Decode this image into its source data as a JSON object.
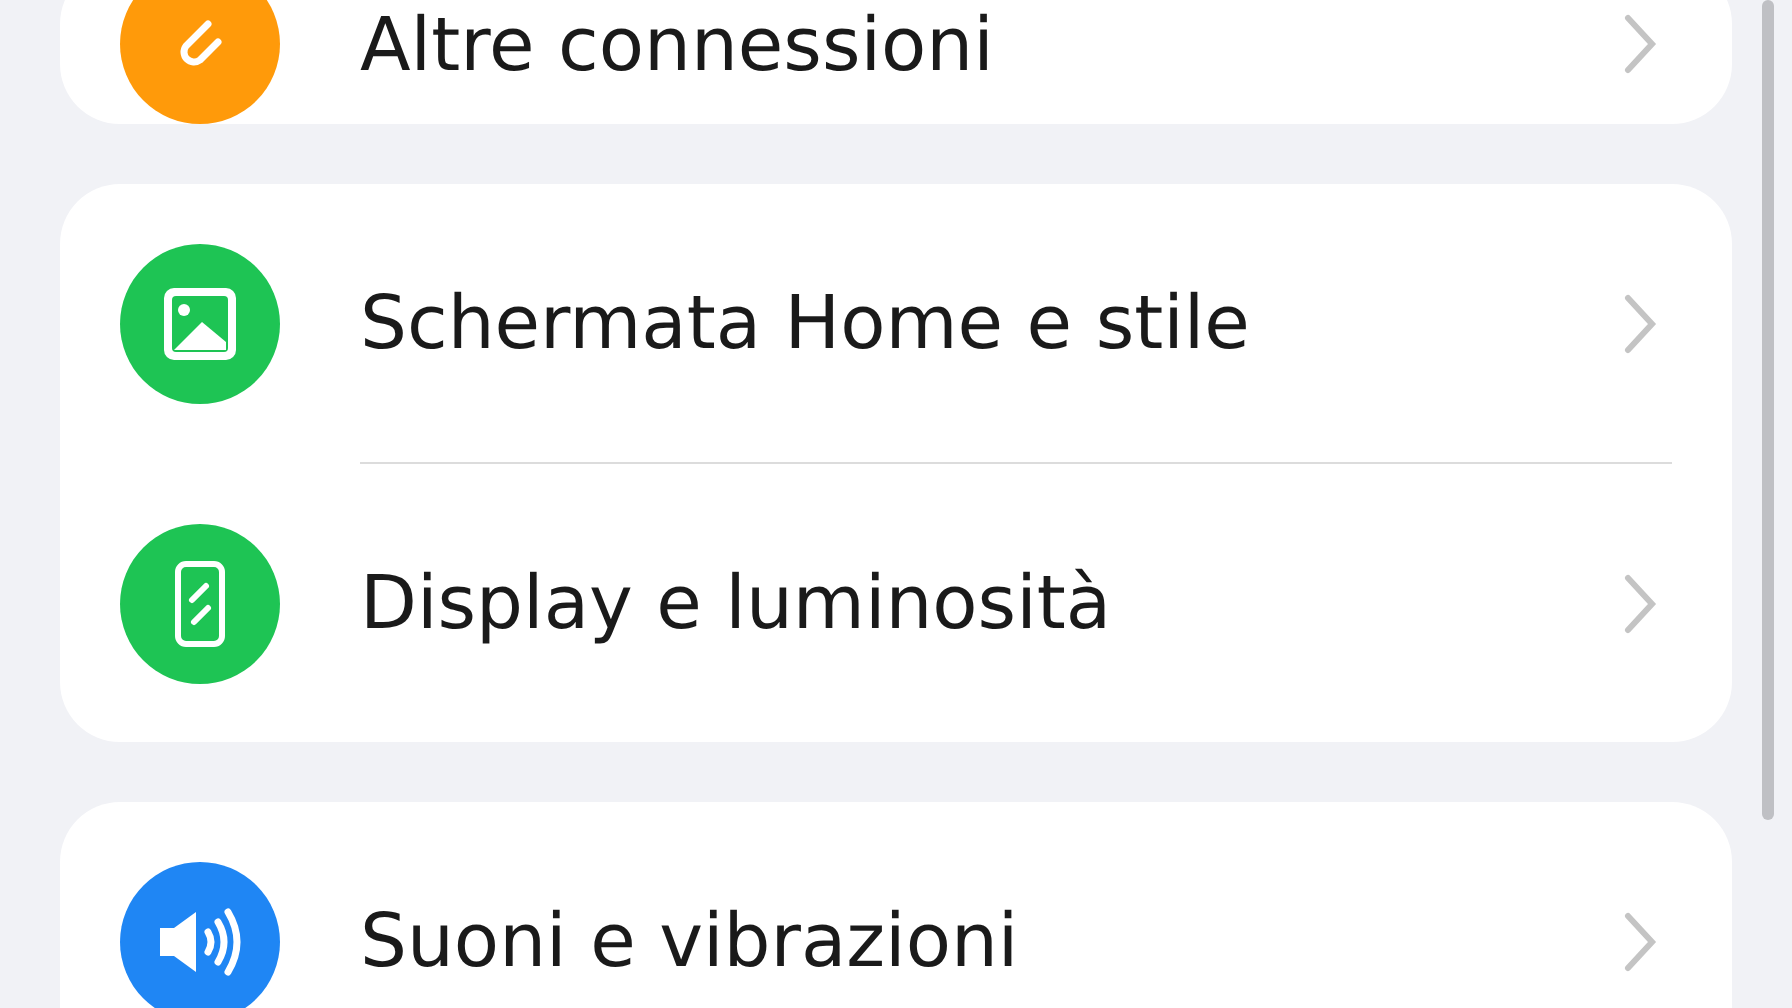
{
  "groups": [
    {
      "items": [
        {
          "label": "Altre connessioni",
          "color": "#ff9a0a"
        }
      ]
    },
    {
      "items": [
        {
          "label": "Schermata Home e stile",
          "color": "#1ec454"
        },
        {
          "label": "Display e luminosità",
          "color": "#1ec454"
        }
      ]
    },
    {
      "items": [
        {
          "label": "Suoni e vibrazioni",
          "color": "#1f86f4"
        }
      ]
    }
  ]
}
